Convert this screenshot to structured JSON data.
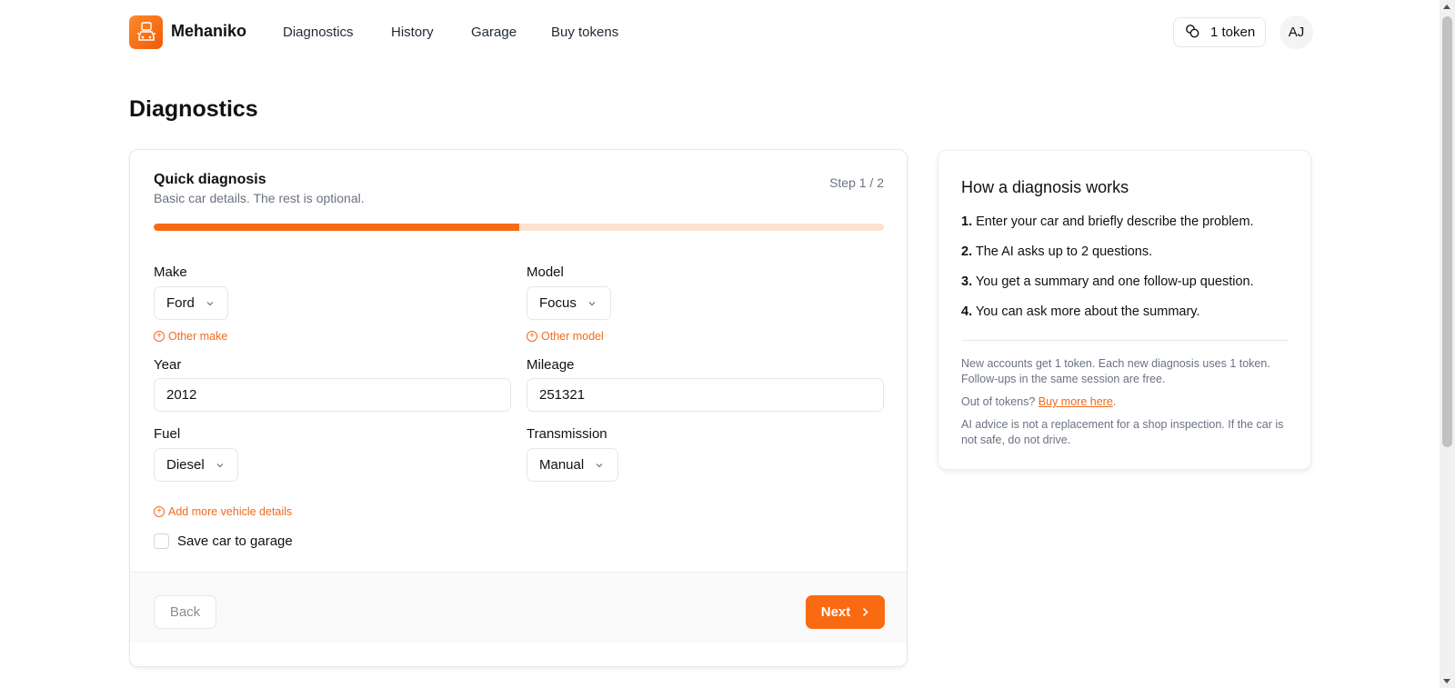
{
  "brand": {
    "name": "Mehaniko",
    "logo_icon": "car-icon"
  },
  "nav": {
    "items": [
      {
        "label": "Diagnostics"
      },
      {
        "label": "History"
      },
      {
        "label": "Garage"
      },
      {
        "label": "Buy tokens"
      }
    ]
  },
  "tokens": {
    "label": "1 token",
    "icon": "coins-icon"
  },
  "user": {
    "initials": "AJ"
  },
  "page": {
    "title": "Diagnostics"
  },
  "form": {
    "title": "Quick diagnosis",
    "subtitle": "Basic car details. The rest is optional.",
    "step_label": "Step 1 / 2",
    "progress_fraction": 0.5,
    "make": {
      "label": "Make",
      "value": "Ford",
      "other_link": "Other make"
    },
    "model": {
      "label": "Model",
      "value": "Focus",
      "other_link": "Other model"
    },
    "year": {
      "label": "Year",
      "value": "2012"
    },
    "mileage": {
      "label": "Mileage",
      "value": "251321"
    },
    "fuel": {
      "label": "Fuel",
      "value": "Diesel"
    },
    "transmission": {
      "label": "Transmission",
      "value": "Manual"
    },
    "add_details_link": "Add more vehicle details",
    "save_car_label": "Save car to garage",
    "save_car_checked": false,
    "back_label": "Back",
    "next_label": "Next"
  },
  "info": {
    "title": "How a diagnosis works",
    "steps": [
      {
        "num": "1.",
        "text": "Enter your car and briefly describe the problem."
      },
      {
        "num": "2.",
        "text": "The AI asks up to 2 questions."
      },
      {
        "num": "3.",
        "text": "You get a summary and one follow-up question."
      },
      {
        "num": "4.",
        "text": "You can ask more about the summary."
      }
    ],
    "note_tokens": "New accounts get 1 token. Each new diagnosis uses 1 token. Follow-ups in the same session are free.",
    "note_out_prefix": "Out of tokens?",
    "note_out_link": "Buy more here",
    "note_out_suffix": ".",
    "note_disclaimer": "AI advice is not a replacement for a shop inspection. If the car is not safe, do not drive."
  },
  "colors": {
    "accent": "#f96a12",
    "progress_track": "#fde1d1"
  }
}
